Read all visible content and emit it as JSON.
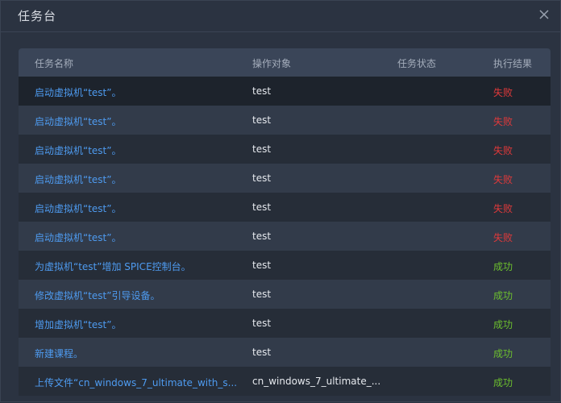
{
  "dialog": {
    "title": "任务台"
  },
  "table": {
    "headers": {
      "name": "任务名称",
      "target": "操作对象",
      "status": "任务状态",
      "result": "执行结果"
    },
    "rows": [
      {
        "name": "启动虚拟机“test”。",
        "target": "test",
        "status": "",
        "result": "失败"
      },
      {
        "name": "启动虚拟机“test”。",
        "target": "test",
        "status": "",
        "result": "失败"
      },
      {
        "name": "启动虚拟机“test”。",
        "target": "test",
        "status": "",
        "result": "失败"
      },
      {
        "name": "启动虚拟机“test”。",
        "target": "test",
        "status": "",
        "result": "失败"
      },
      {
        "name": "启动虚拟机“test”。",
        "target": "test",
        "status": "",
        "result": "失败"
      },
      {
        "name": "启动虚拟机“test”。",
        "target": "test",
        "status": "",
        "result": "失败"
      },
      {
        "name": "为虚拟机“test”增加 SPICE控制台。",
        "target": "test",
        "status": "",
        "result": "成功"
      },
      {
        "name": "修改虚拟机“test”引导设备。",
        "target": "test",
        "status": "",
        "result": "成功"
      },
      {
        "name": "增加虚拟机“test”。",
        "target": "test",
        "status": "",
        "result": "成功"
      },
      {
        "name": "新建课程。",
        "target": "test",
        "status": "",
        "result": "成功"
      },
      {
        "name": "上传文件“cn_windows_7_ultimate_with_s...",
        "target": "cn_windows_7_ultimate_...",
        "status": "",
        "result": "成功"
      }
    ]
  },
  "colors": {
    "fail": "#e0393a",
    "success": "#6cbf2e",
    "link": "#4e9bf0"
  },
  "icons": {
    "close": "close-icon"
  }
}
